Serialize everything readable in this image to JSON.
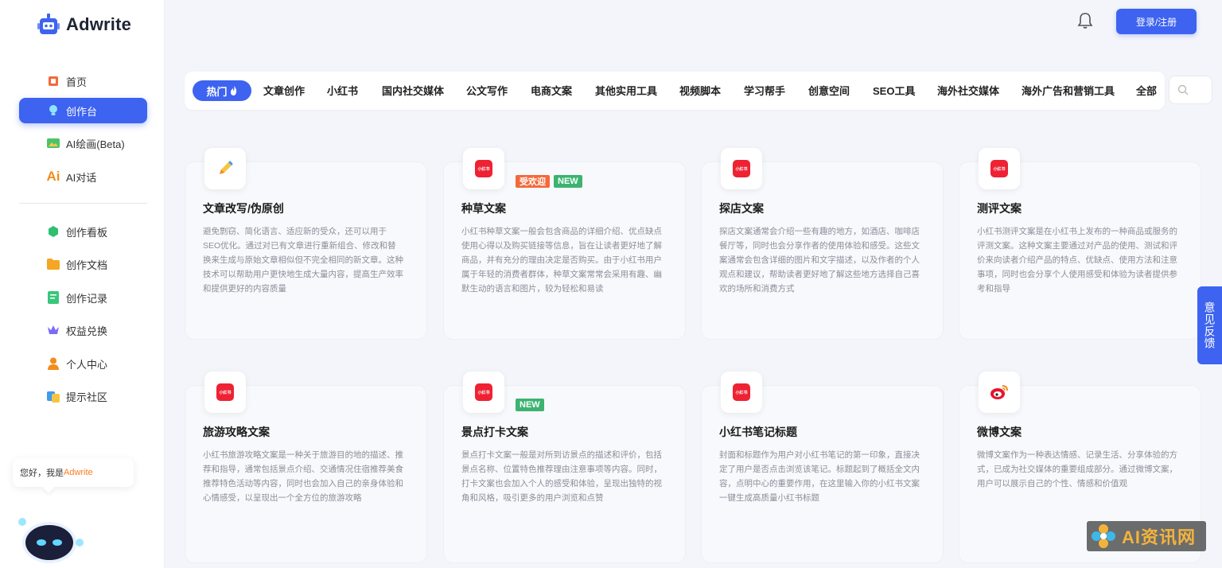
{
  "app": {
    "name": "Adwrite"
  },
  "sidebar": {
    "items": [
      {
        "label": "首页",
        "icon": "home-icon"
      },
      {
        "label": "创作台",
        "icon": "bulb-icon",
        "active": true
      },
      {
        "label": "AI绘画(Beta)",
        "icon": "image-icon"
      },
      {
        "label": "AI对话",
        "icon": "ai-chat-icon"
      },
      {
        "label": "创作看板",
        "icon": "dashboard-icon"
      },
      {
        "label": "创作文档",
        "icon": "folder-icon"
      },
      {
        "label": "创作记录",
        "icon": "record-icon"
      },
      {
        "label": "权益兑换",
        "icon": "crown-icon"
      },
      {
        "label": "个人中心",
        "icon": "user-icon"
      },
      {
        "label": "提示社区",
        "icon": "community-icon"
      }
    ],
    "greeting_prefix": "您好，我是",
    "greeting_brand": "Adwrite"
  },
  "header": {
    "login_label": "登录/注册"
  },
  "tabs": [
    {
      "label": "热门"
    },
    {
      "label": "文章创作"
    },
    {
      "label": "小红书"
    },
    {
      "label": "国内社交媒体"
    },
    {
      "label": "公文写作"
    },
    {
      "label": "电商文案"
    },
    {
      "label": "其他实用工具"
    },
    {
      "label": "视频脚本"
    },
    {
      "label": "学习帮手"
    },
    {
      "label": "创意空间"
    },
    {
      "label": "SEO工具"
    },
    {
      "label": "海外社交媒体"
    },
    {
      "label": "海外广告和营销工具"
    },
    {
      "label": "全部"
    }
  ],
  "cards": [
    {
      "title": "文章改写/伪原创",
      "icon": "pen-icon",
      "badges": [],
      "desc": "避免剽窃、简化语言、适应新的受众，还可以用于SEO优化。通过对已有文章进行重新组合、修改和替换来生成与原始文章相似但不完全相同的新文章。这种技术可以帮助用户更快地生成大量内容，提高生产效率和提供更好的内容质量"
    },
    {
      "title": "种草文案",
      "icon": "xiaohongshu-icon",
      "badges": [
        "受欢迎",
        "NEW"
      ],
      "desc": "小红书种草文案一般会包含商品的详细介绍、优点缺点使用心得以及购买链接等信息，旨在让读者更好地了解商品，并有充分的理由决定是否购买。由于小红书用户属于年轻的消费者群体，种草文案常常会采用有趣、幽默生动的语言和图片，较为轻松和易读"
    },
    {
      "title": "探店文案",
      "icon": "xiaohongshu-icon",
      "badges": [],
      "desc": "探店文案通常会介绍一些有趣的地方，如酒店、咖啡店餐厅等，同时也会分享作者的使用体验和感受。这些文案通常会包含详细的图片和文字描述，以及作者的个人观点和建议，帮助读者更好地了解这些地方选择自己喜欢的场所和消费方式"
    },
    {
      "title": "测评文案",
      "icon": "xiaohongshu-icon",
      "badges": [],
      "desc": "小红书测评文案是在小红书上发布的一种商品或服务的评测文案。这种文案主要通过对产品的使用、测试和评价来向读者介绍产品的特点、优缺点、使用方法和注意事项，同时也会分享个人使用感受和体验为读者提供参考和指导"
    },
    {
      "title": "旅游攻略文案",
      "icon": "xiaohongshu-icon",
      "badges": [],
      "desc": "小红书旅游攻略文案是一种关于旅游目的地的描述、推荐和指导，通常包括景点介绍、交通情况住宿推荐美食推荐特色活动等内容，同时也会加入自己的亲身体验和心情感受，以呈现出一个全方位的旅游攻略"
    },
    {
      "title": "景点打卡文案",
      "icon": "xiaohongshu-icon",
      "badges": [
        "NEW"
      ],
      "desc": "景点打卡文案一般是对所到访景点的描述和评价，包括景点名称、位置特色推荐理由注意事项等内容。同时，打卡文案也会加入个人的感受和体验，呈现出独特的视角和风格，吸引更多的用户浏览和点赞"
    },
    {
      "title": "小红书笔记标题",
      "icon": "xiaohongshu-icon",
      "badges": [],
      "desc": "封面和标题作为用户对小红书笔记的第一印象，直接决定了用户是否点击浏览该笔记。标题起到了概括全文内容，点明中心的重要作用，在这里输入你的小红书文案一键生成高质量小红书标题"
    },
    {
      "title": "微博文案",
      "icon": "weibo-icon",
      "badges": [],
      "desc": "微博文案作为一种表达情感、记录生活、分享体验的方式，已成为社交媒体的重要组成部分。通过微博文案，用户可以展示自己的个性、情感和价值观"
    }
  ],
  "feedback_label": "意见反馈",
  "watermark": "AI资讯网",
  "colors": {
    "accent": "#3d63f0",
    "badge_popular": "#f26a3b",
    "badge_new": "#3cb371",
    "xiaohongshu": "#ee2233"
  }
}
